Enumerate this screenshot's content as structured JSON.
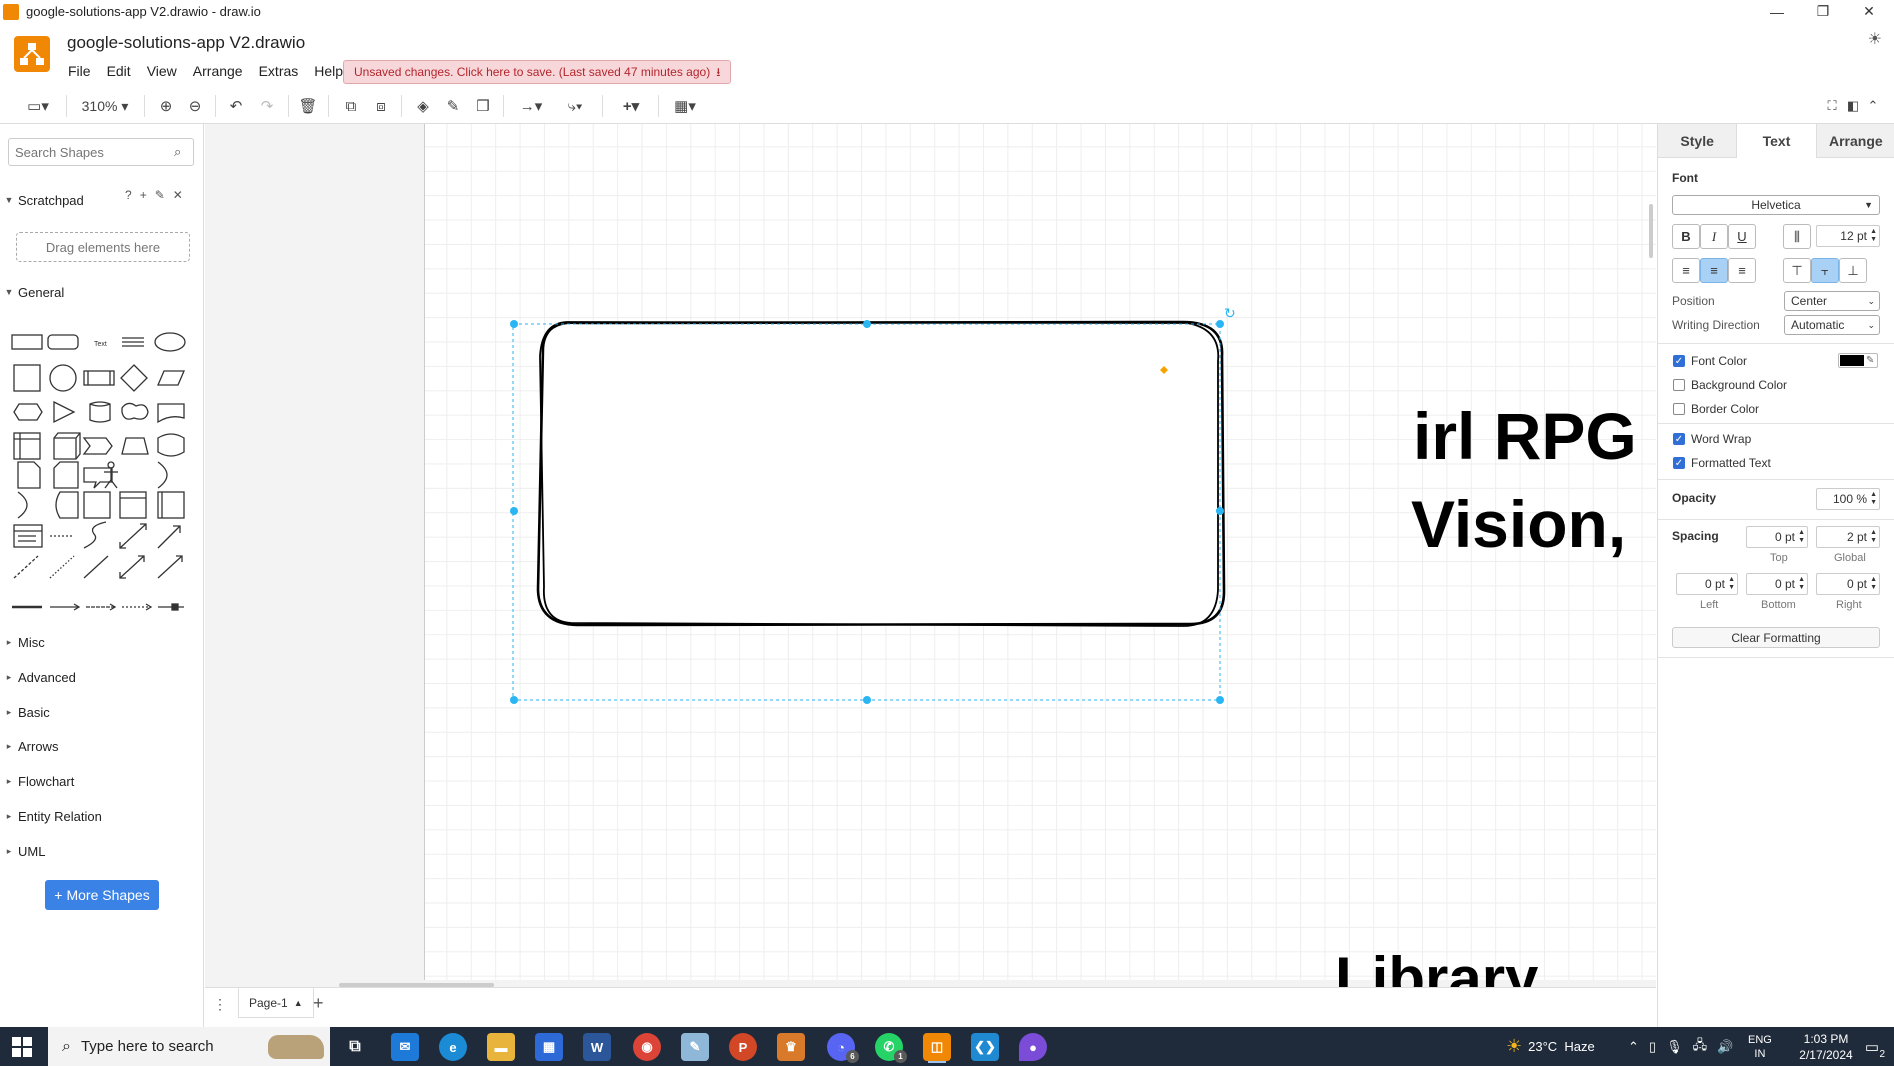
{
  "window": {
    "title": "google-solutions-app V2.drawio - draw.io",
    "minimize": "—",
    "restore": "❐",
    "close": "✕"
  },
  "header": {
    "filename": "google-solutions-app V2.drawio",
    "menus": [
      "File",
      "Edit",
      "View",
      "Arrange",
      "Extras",
      "Help"
    ],
    "unsaved_notice": "Unsaved changes. Click here to save. (Last saved 47 minutes ago)"
  },
  "toolbar": {
    "zoom": "310%"
  },
  "sidebar": {
    "search_placeholder": "Search Shapes",
    "scratchpad_label": "Scratchpad",
    "dropzone_label": "Drag elements here",
    "general_label": "General",
    "sections": [
      "Misc",
      "Advanced",
      "Basic",
      "Arrows",
      "Flowchart",
      "Entity Relation",
      "UML"
    ],
    "more_shapes": "More Shapes"
  },
  "canvas": {
    "text_fragment_1_line1": "irl RPG",
    "text_fragment_1_line2": "Vision,",
    "text_fragment_2": "Library"
  },
  "pages": {
    "current": "Page-1"
  },
  "format_panel": {
    "tabs": [
      "Style",
      "Text",
      "Arrange"
    ],
    "active_tab": "Text",
    "font_section": "Font",
    "font_family": "Helvetica",
    "bold": "B",
    "italic": "I",
    "underline": "U",
    "font_size": "12 pt",
    "position_label": "Position",
    "position_value": "Center",
    "writing_direction_label": "Writing Direction",
    "writing_direction_value": "Automatic",
    "font_color_label": "Font Color",
    "font_color_value": "#000000",
    "background_color_label": "Background Color",
    "border_color_label": "Border Color",
    "word_wrap_label": "Word Wrap",
    "formatted_text_label": "Formatted Text",
    "checks": {
      "font_color": true,
      "background_color": false,
      "border_color": false,
      "word_wrap": true,
      "formatted_text": true
    },
    "opacity_label": "Opacity",
    "opacity_value": "100 %",
    "spacing_label": "Spacing",
    "spacing_top": "0 pt",
    "spacing_global": "2 pt",
    "spacing_left": "0 pt",
    "spacing_bottom": "0 pt",
    "spacing_right": "0 pt",
    "top_label": "Top",
    "global_label": "Global",
    "left_label": "Left",
    "bottom_label": "Bottom",
    "right_label": "Right",
    "clear_formatting": "Clear Formatting"
  },
  "taskbar": {
    "search_placeholder": "Type here to search",
    "weather": "23°C  Haze",
    "lang_line1": "ENG",
    "lang_line2": "IN",
    "time": "1:03 PM",
    "date": "2/17/2024",
    "notification_count": "2",
    "discord_badge": "6",
    "whatsapp_badge": "1"
  },
  "colors": {
    "accent": "#f08705",
    "selection": "#29b6f2",
    "unsaved_bg": "#f8d7da",
    "unsaved_text": "#b3262d",
    "more_shapes_bg": "#3b82e6",
    "taskbar_bg": "#1f2b3a"
  }
}
